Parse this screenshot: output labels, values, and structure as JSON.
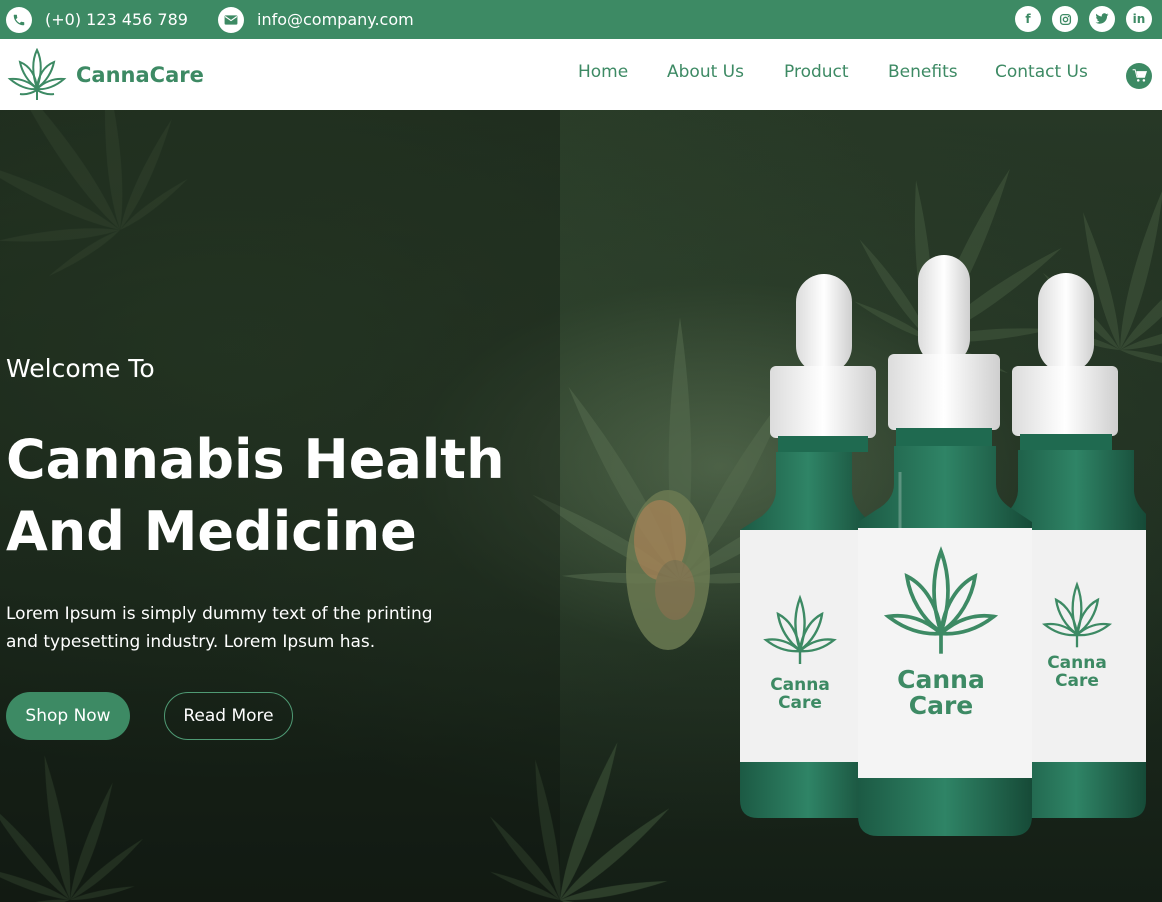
{
  "topbar": {
    "phone": "(+0) 123 456 789",
    "email": "info@company.com",
    "social": [
      "facebook-icon",
      "instagram-icon",
      "twitter-icon",
      "linkedin-icon"
    ]
  },
  "header": {
    "logo_text": "CannaCare",
    "nav": [
      "Home",
      "About Us",
      "Product",
      "Benefits",
      "Contact Us"
    ]
  },
  "hero": {
    "welcome": "Welcome To",
    "title_line1": "Cannabis Health",
    "title_line2": "And Medicine",
    "description_line1": "Lorem Ipsum is simply dummy text of the printing",
    "description_line2": "and typesetting industry. Lorem Ipsum has.",
    "shop_button": "Shop Now",
    "read_button": "Read More"
  },
  "bottles": {
    "label_line1": "Canna",
    "label_line2": "Care"
  },
  "colors": {
    "brand": "#3d8a64",
    "white": "#ffffff",
    "hero_dark": "#1d2b1e"
  }
}
